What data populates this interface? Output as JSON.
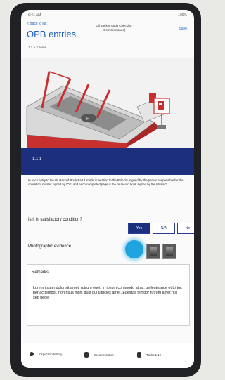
{
  "status": {
    "time": "9:41 AM",
    "battery": "100%"
  },
  "nav": {
    "back_label": "< Back to list",
    "center_line1": "Oil Tanker Audit Checklist",
    "center_line2": "(Commissioned)",
    "save_label": "Save"
  },
  "page_title": "OPB entries",
  "breadcrumb": "1.1 > 3 items",
  "section": {
    "number": "1.1.1"
  },
  "instruction": "In each entry to the Oil Record Book Part 1 made in relation to the Rule 15, signed by the person responsible for the operation, master signed by IOE, and each completed page is the oil record book signed by the Master?",
  "question": {
    "label": "Is it in satisfactory condition?",
    "options": [
      "Yes",
      "N/A",
      "No"
    ],
    "selected": "Yes"
  },
  "photo_label": "Photographic evidence",
  "remarks": {
    "label": "Remarks",
    "text": "Lorem ipsum dolor sit amet, rutrum eget. In ipsum commodo at ac, pellentesque et tortor, per ac tempor, non risus nibh, quis dui ultricies amet. Egestas tempor rutrum amet nisl sed pede."
  },
  "tabs": [
    {
      "label": "Inspection history",
      "icon": "location-pin-icon"
    },
    {
      "label": "Documentation",
      "icon": "document-icon"
    },
    {
      "label": "Tablet 1/12",
      "icon": "tablet-icon"
    }
  ],
  "colors": {
    "accent": "#1f5fbf",
    "section_bar": "#1b2f7c",
    "vessel_red": "#c8302f"
  }
}
